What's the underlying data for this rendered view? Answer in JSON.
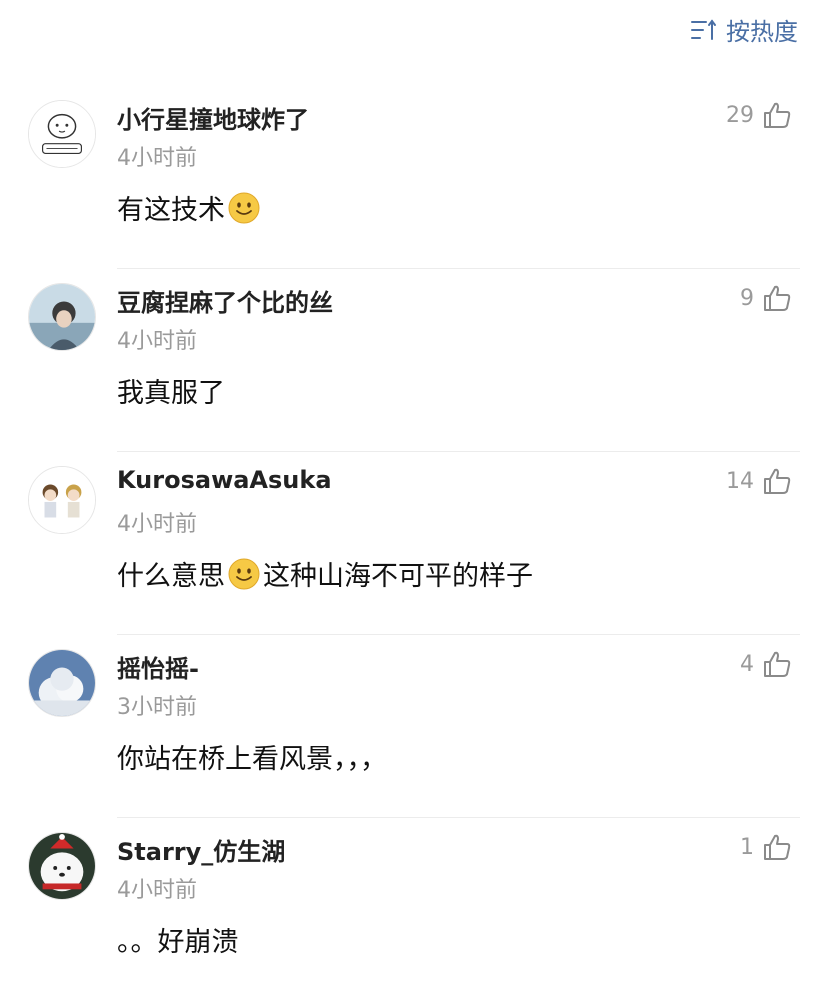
{
  "sort": {
    "label": "按热度",
    "icon": "sort-icon"
  },
  "comments": [
    {
      "user": "小行星撞地球炸了",
      "time": "4小时前",
      "likes": "29",
      "text_before": "有这技术",
      "emoji": "smile-emoji",
      "text_after": ""
    },
    {
      "user": "豆腐捏麻了个比的丝",
      "time": "4小时前",
      "likes": "9",
      "text_before": "我真服了",
      "emoji": "",
      "text_after": ""
    },
    {
      "user": "KurosawaAsuka",
      "time": "4小时前",
      "likes": "14",
      "text_before": "什么意思",
      "emoji": "smile-emoji",
      "text_after": "这种山海不可平的样子"
    },
    {
      "user": "摇怡摇-",
      "time": "3小时前",
      "likes": "4",
      "text_before": "你站在桥上看风景，，，",
      "emoji": "",
      "text_after": ""
    },
    {
      "user": "Starry_仿生湖",
      "time": "4小时前",
      "likes": "1",
      "text_before": "。。好崩溃",
      "emoji": "",
      "text_after": ""
    }
  ],
  "colors": {
    "accent": "#4a6fa5",
    "muted": "#9a9a9a",
    "divider": "#ececec",
    "emoji": "#f6c945"
  }
}
